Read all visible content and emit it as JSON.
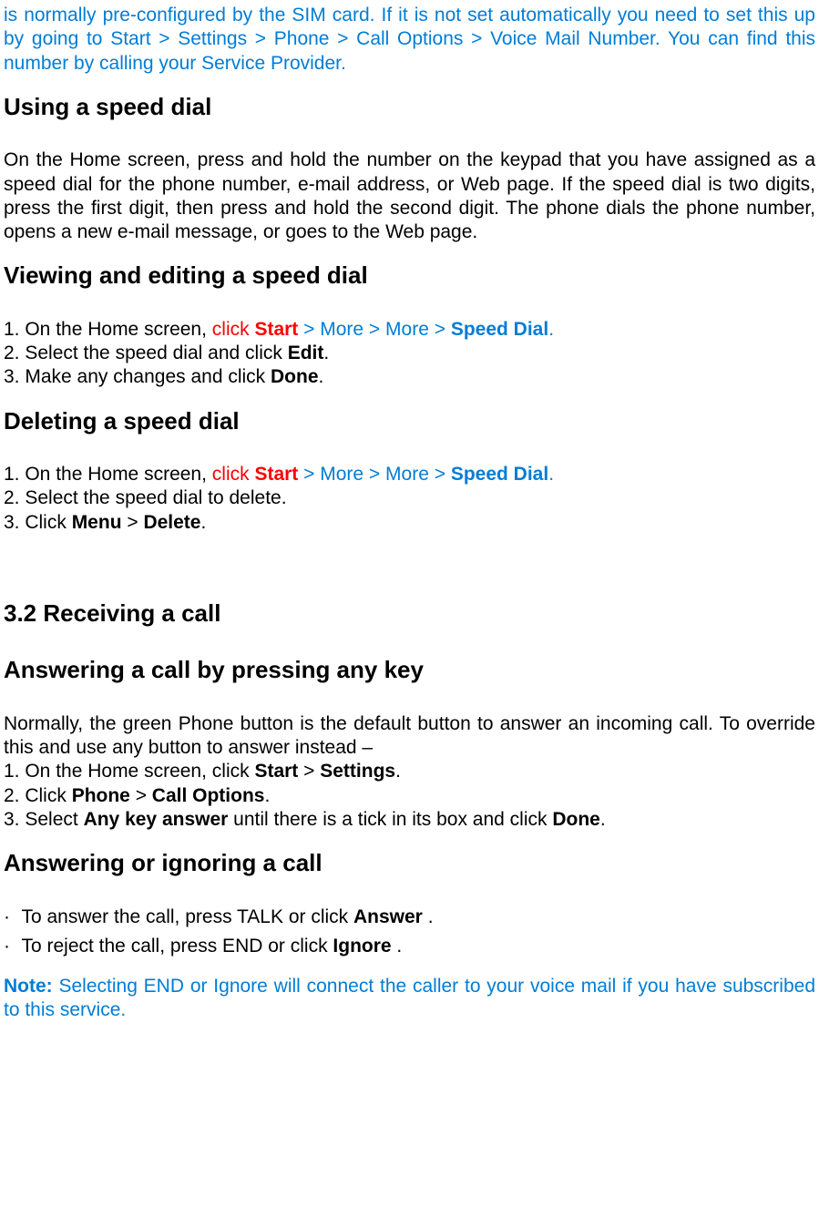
{
  "intro": {
    "p1a": "is normally pre-configured by the SIM card. If it is not set automatically you need to set this up by going to Start > Settings > Phone > Call Options > Voice Mail Number. You can find this number by calling your Service Provider."
  },
  "using_speed_dial": {
    "title": "Using a speed dial",
    "body": "On the Home screen, press and hold the number on the keypad that you have assigned as a speed dial for the phone number, e-mail address, or Web page. If the speed dial is two digits, press the first digit, then press and hold the second digit. The phone dials the phone number, opens a new e-mail message, or goes to the Web page."
  },
  "viewing_editing": {
    "title": "Viewing and editing a speed dial",
    "s1_pre": "1. On the Home screen, ",
    "s1_click": "click ",
    "s1_start": "Start",
    "s1_gt1": " > ",
    "s1_more": "More > More > ",
    "s1_sd": "Speed Dial",
    "s1_dot": ".",
    "s2_a": "2. Select the speed dial and click ",
    "s2_b": "Edit",
    "s2_c": ".",
    "s3_a": "3. Make any changes and click ",
    "s3_b": "Done",
    "s3_c": "."
  },
  "deleting": {
    "title": "Deleting a speed dial",
    "s1_pre": "1. On the Home screen, ",
    "s1_click": "click ",
    "s1_start": "Start",
    "s1_gt1": " > ",
    "s1_more": "More > More > ",
    "s1_sd": "Speed Dial",
    "s1_dot": ".",
    "s2": "2. Select the speed dial to delete.",
    "s3_a": "3. Click ",
    "s3_b": "Menu",
    "s3_c": " > ",
    "s3_d": "Delete",
    "s3_e": "."
  },
  "receiving": {
    "title": "3.2 Receiving a call"
  },
  "answering_any": {
    "title": "Answering a call by pressing any key",
    "intro": "Normally, the green Phone button is the default button to answer an incoming call. To override this and use any button to answer instead –",
    "s1_a": "1. On the Home screen, click ",
    "s1_b": "Start",
    "s1_c": " > ",
    "s1_d": "Settings",
    "s1_e": ".",
    "s2_a": "2. Click ",
    "s2_b": "Phone",
    "s2_c": " > ",
    "s2_d": "Call Options",
    "s2_e": ".",
    "s3_a": "3. Select ",
    "s3_b": "Any key answer",
    "s3_c": " until there is a tick in its box and click ",
    "s3_d": "Done",
    "s3_e": "."
  },
  "answer_ignore": {
    "title": "Answering or ignoring a call",
    "b1_a": "To answer the call, press TALK or click ",
    "b1_b": "Answer",
    "b1_c": " .",
    "b2_a": "To reject the call, press END or click ",
    "b2_b": "Ignore",
    "b2_c": " ."
  },
  "note": {
    "label": "Note:",
    "body": " Selecting END or Ignore will connect the caller to your voice mail if you have subscribed to this service."
  }
}
